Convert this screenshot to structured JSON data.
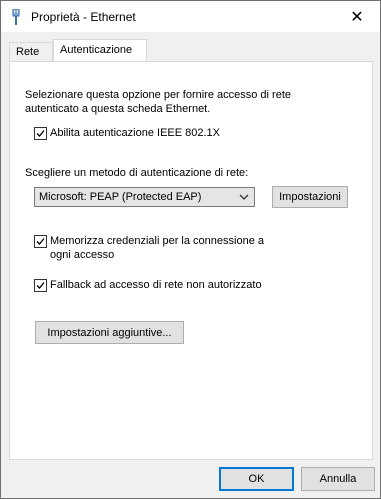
{
  "window": {
    "title": "Proprietà - Ethernet",
    "close_glyph": "✕"
  },
  "tabs": [
    {
      "label": "Rete",
      "selected": false
    },
    {
      "label": "Autenticazione",
      "selected": true
    }
  ],
  "auth": {
    "description": "Selezionare questa opzione per fornire accesso di rete autenticato a questa scheda Ethernet.",
    "enable_8021x": {
      "label": "Abilita autenticazione IEEE 802.1X",
      "checked": true
    },
    "method_label": "Scegliere un metodo di autenticazione di rete:",
    "method_select": {
      "value": "Microsoft: PEAP (Protected EAP)"
    },
    "settings_button": "Impostazioni",
    "remember_credentials": {
      "label": "Memorizza credenziali per la connessione a ogni accesso",
      "checked": true
    },
    "fallback": {
      "label": "Fallback ad accesso di rete non autorizzato",
      "checked": true
    },
    "additional_settings_button": "Impostazioni aggiuntive..."
  },
  "footer": {
    "ok_label": "OK",
    "cancel_label": "Annulla"
  },
  "colors": {
    "accent": "#0078d7",
    "panel_bg": "#ffffff",
    "window_bg": "#f0f0f0"
  },
  "icons": {
    "title": "network-cable-icon",
    "close": "close-icon",
    "checkbox": "checkmark-icon",
    "select": "chevron-down-icon"
  }
}
